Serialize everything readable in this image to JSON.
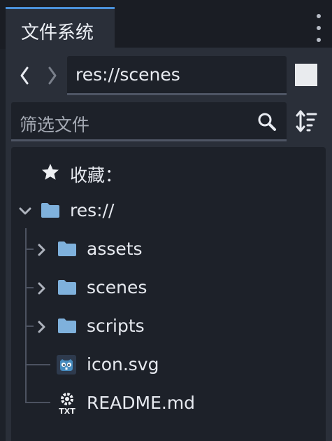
{
  "panel": {
    "tab_title": "文件系统",
    "accent_color": "#4a90d9"
  },
  "toolbar": {
    "back_icon": "chevron-left-icon",
    "forward_icon": "chevron-right-icon",
    "path_value": "res://scenes",
    "filter_placeholder": "筛选文件",
    "search_icon": "search-icon",
    "sort_icon": "sort-icon"
  },
  "tree": {
    "favorites_label": "收藏：",
    "root": {
      "label": "res://",
      "expanded": true
    },
    "items": [
      {
        "label": "assets",
        "type": "folder",
        "icon": "folder-icon"
      },
      {
        "label": "scenes",
        "type": "folder",
        "icon": "folder-icon"
      },
      {
        "label": "scripts",
        "type": "folder",
        "icon": "folder-icon"
      },
      {
        "label": "icon.svg",
        "type": "file",
        "icon": "godot-icon"
      },
      {
        "label": "README.md",
        "type": "file",
        "icon": "text-file-icon"
      }
    ]
  },
  "colors": {
    "folder": "#7fb1dc",
    "godot": "#478cbf",
    "background": "#1d2129"
  }
}
